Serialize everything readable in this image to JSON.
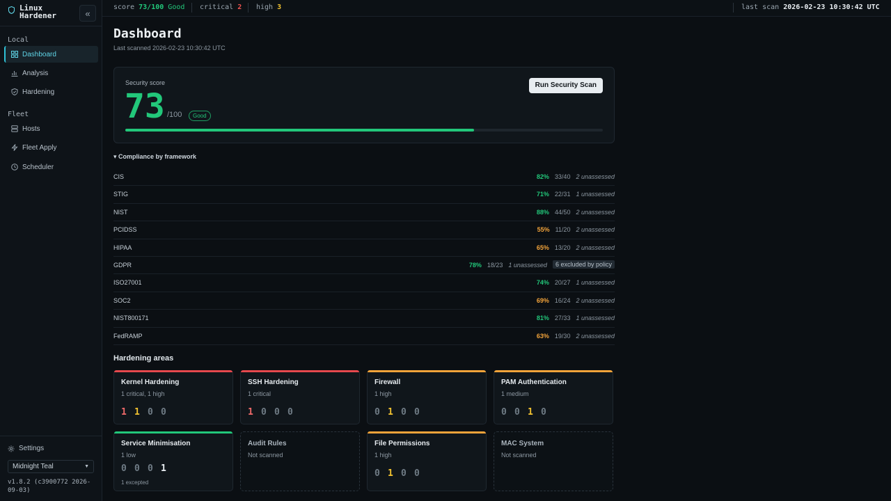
{
  "app": {
    "name": "Linux Hardener",
    "collapse_icon": "«"
  },
  "sidebar": {
    "sections": [
      {
        "label": "Local",
        "items": [
          {
            "label": "Dashboard",
            "icon": "dashboard-icon",
            "active": true
          },
          {
            "label": "Analysis",
            "icon": "chart-icon"
          },
          {
            "label": "Hardening",
            "icon": "shield-icon"
          }
        ]
      },
      {
        "label": "Fleet",
        "items": [
          {
            "label": "Hosts",
            "icon": "server-icon"
          },
          {
            "label": "Fleet Apply",
            "icon": "bolt-icon"
          },
          {
            "label": "Scheduler",
            "icon": "clock-icon"
          }
        ]
      }
    ],
    "settings_label": "Settings",
    "theme_value": "Midnight Teal",
    "version": "v1.8.2 (c3900772 2026-09-03)"
  },
  "topbar": {
    "score_label": "score",
    "score_value": "73/100",
    "score_rating": "Good",
    "critical_label": "critical",
    "critical_value": "2",
    "high_label": "high",
    "high_value": "3",
    "last_scan_label": "last scan",
    "last_scan_value": "2026-02-23 10:30:42 UTC"
  },
  "dashboard": {
    "title": "Dashboard",
    "last_scanned": "Last scanned 2026-02-23 10:30:42 UTC",
    "score_label": "Security score",
    "score": "73",
    "score_max": "/100",
    "score_fraction": 0.73,
    "score_badge": "Good",
    "run_button": "Run Security Scan",
    "compliance_toggle": "▾ Compliance by framework",
    "compliance": [
      {
        "name": "CIS",
        "pct": "82%",
        "count": "33/40",
        "unassessed": "2 unassessed",
        "color": "#22c77a"
      },
      {
        "name": "STIG",
        "pct": "71%",
        "count": "22/31",
        "unassessed": "1 unassessed",
        "color": "#22c77a"
      },
      {
        "name": "NIST",
        "pct": "88%",
        "count": "44/50",
        "unassessed": "2 unassessed",
        "color": "#22c77a"
      },
      {
        "name": "PCIDSS",
        "pct": "55%",
        "count": "11/20",
        "unassessed": "2 unassessed",
        "color": "#f2a33a"
      },
      {
        "name": "HIPAA",
        "pct": "65%",
        "count": "13/20",
        "unassessed": "2 unassessed",
        "color": "#f2a33a"
      },
      {
        "name": "GDPR",
        "pct": "78%",
        "count": "18/23",
        "unassessed": "1 unassessed",
        "excluded": "6 excluded by policy",
        "color": "#22c77a"
      },
      {
        "name": "ISO27001",
        "pct": "74%",
        "count": "20/27",
        "unassessed": "1 unassessed",
        "color": "#22c77a"
      },
      {
        "name": "SOC2",
        "pct": "69%",
        "count": "16/24",
        "unassessed": "2 unassessed",
        "color": "#f2a33a"
      },
      {
        "name": "NIST800171",
        "pct": "81%",
        "count": "27/33",
        "unassessed": "1 unassessed",
        "color": "#22c77a"
      },
      {
        "name": "FedRAMP",
        "pct": "63%",
        "count": "19/30",
        "unassessed": "2 unassessed",
        "color": "#f2a33a"
      }
    ],
    "areas_title": "Hardening areas",
    "areas": [
      {
        "title": "Kernel Hardening",
        "sub": "1 critical, 1 high",
        "accent": "#e5484d",
        "counts": [
          "1",
          "1",
          "0",
          "0"
        ]
      },
      {
        "title": "SSH Hardening",
        "sub": "1 critical",
        "accent": "#e5484d",
        "counts": [
          "1",
          "0",
          "0",
          "0"
        ]
      },
      {
        "title": "Firewall",
        "sub": "1 high",
        "accent": "#f2a33a",
        "counts": [
          "0",
          "1",
          "0",
          "0"
        ]
      },
      {
        "title": "PAM Authentication",
        "sub": "1 medium",
        "accent": "#f2a33a",
        "counts": [
          "0",
          "0",
          "1",
          "0"
        ]
      },
      {
        "title": "Service Minimisation",
        "sub": "1 low",
        "accent": "#22c77a",
        "counts": [
          "0",
          "0",
          "0",
          "1"
        ],
        "excepted": "1 excepted"
      },
      {
        "title": "Audit Rules",
        "sub": "Not scanned",
        "dashed": true
      },
      {
        "title": "File Permissions",
        "sub": "1 high",
        "accent": "#f2a33a",
        "counts": [
          "0",
          "1",
          "0",
          "0"
        ]
      },
      {
        "title": "MAC System",
        "sub": "Not scanned",
        "dashed": true
      }
    ]
  }
}
